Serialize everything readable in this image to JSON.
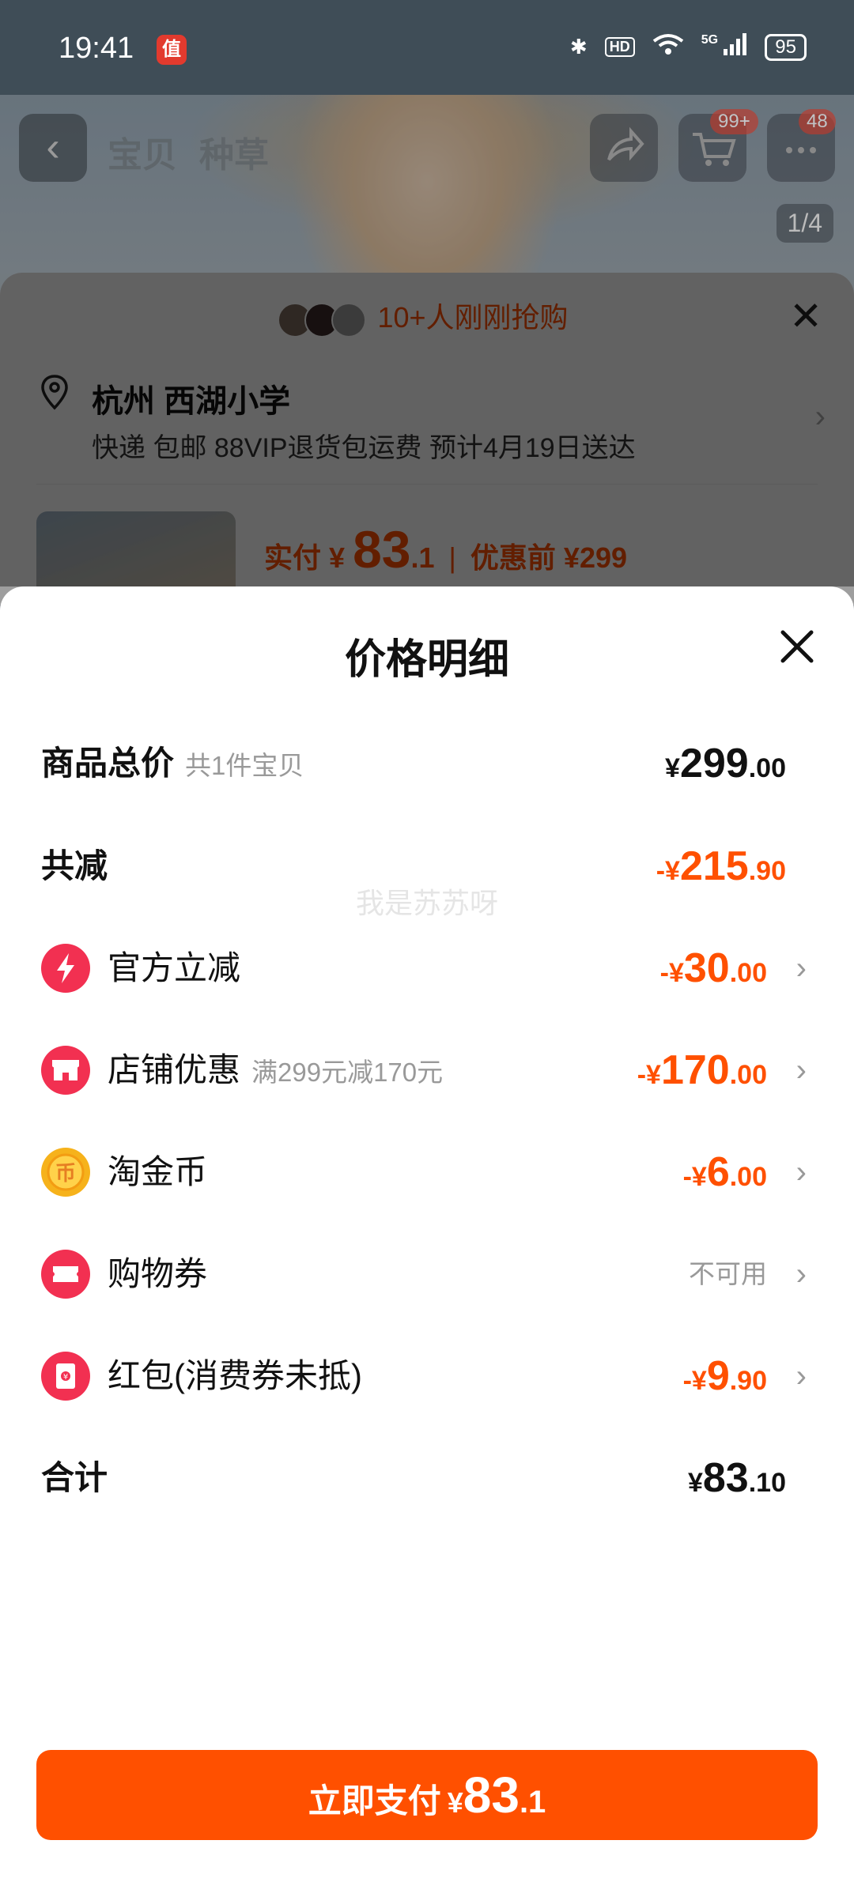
{
  "status_bar": {
    "time": "19:41",
    "app_badge": "值",
    "network": "5G",
    "hd": "HD",
    "battery": "95"
  },
  "background": {
    "tabs": [
      "宝贝",
      "种草"
    ],
    "cart_badge": "99+",
    "message_badge": "48",
    "photo_index": "1/4",
    "buyers_text": "10+人刚刚抢购",
    "address_title": "杭州 西湖小学",
    "delivery_text": "快递 包邮 88VIP退货包运费 预计4月19日送达",
    "paid_label": "实付",
    "paid_yen": "¥",
    "paid_amount": "83",
    "paid_decimal": ".1",
    "before_label": "优惠前 ¥299"
  },
  "sheet": {
    "title": "价格明细",
    "watermark": "我是苏苏呀",
    "rows": [
      {
        "label": "商品总价",
        "hint": "共1件宝贝",
        "yen": "¥",
        "int": "299",
        "dec": ".00"
      },
      {
        "label": "共减",
        "yen": "-¥",
        "int": "215",
        "dec": ".90"
      },
      {
        "label": "官方立减",
        "icon": "lightning-icon",
        "yen": "-¥",
        "int": "30",
        "dec": ".00"
      },
      {
        "label": "店铺优惠",
        "hint": "满299元减170元",
        "icon": "shop-icon",
        "yen": "-¥",
        "int": "170",
        "dec": ".00"
      },
      {
        "label": "淘金币",
        "icon": "taojinbi-coin-icon",
        "yen": "-¥",
        "int": "6",
        "dec": ".00"
      },
      {
        "label": "购物券",
        "icon": "ticket-icon",
        "status": "不可用"
      },
      {
        "label": "红包(消费券未抵)",
        "icon": "red-envelope-icon",
        "yen": "-¥",
        "int": "9",
        "dec": ".90"
      },
      {
        "label": "合计",
        "yen": "¥",
        "int": "83",
        "dec": ".10"
      }
    ],
    "pay_button": {
      "label": "立即支付",
      "yen": "¥",
      "int": "83",
      "dec": ".1"
    }
  },
  "colors": {
    "accent": "#ff5000",
    "icon_red": "#f23051",
    "icon_gold": "#f6b21b"
  }
}
